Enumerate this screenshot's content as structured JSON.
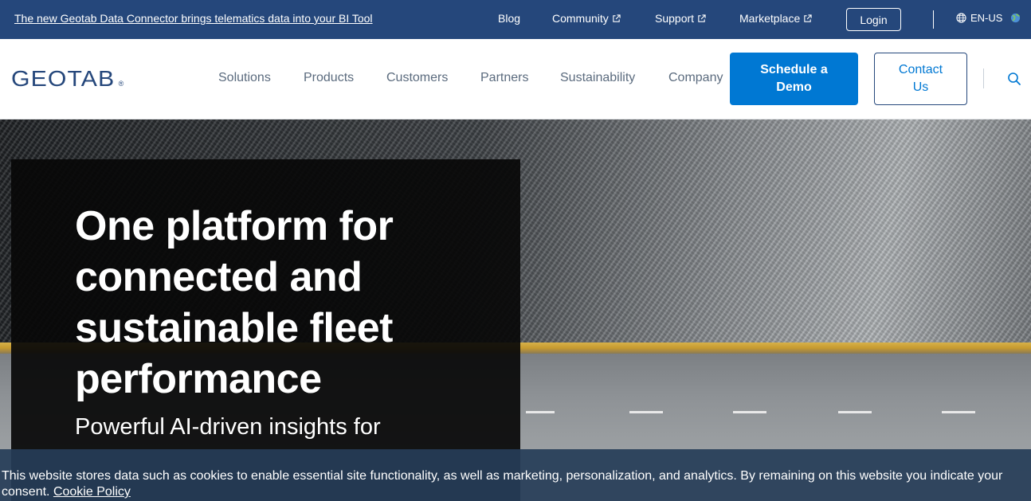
{
  "topbar": {
    "announcement": "The new Geotab Data Connector brings telematics data into your BI Tool",
    "links": [
      "Blog",
      "Community",
      "Support",
      "Marketplace"
    ],
    "login_label": "Login",
    "locale": "EN-US"
  },
  "nav": {
    "logo_text": "GEOTAB",
    "logo_mark": "®",
    "items": [
      "Solutions",
      "Products",
      "Customers",
      "Partners",
      "Sustainability",
      "Company"
    ],
    "demo_label": "Schedule a Demo",
    "contact_label": "Contact Us"
  },
  "hero": {
    "title": "One platform for connected and sustainable fleet performance",
    "subtitle": "Powerful AI-driven insights for"
  },
  "cookie": {
    "text": "This website stores data such as cookies to enable essential site functionality, as well as marketing, personalization, and analytics. By remaining on this website you indicate your consent. ",
    "link_label": "Cookie Policy"
  },
  "colors": {
    "topbar": "#25477b",
    "accent": "#0078d3",
    "nav_text": "#5b6b7e"
  },
  "icons": [
    "external-link-icon",
    "globe-icon",
    "search-icon"
  ]
}
